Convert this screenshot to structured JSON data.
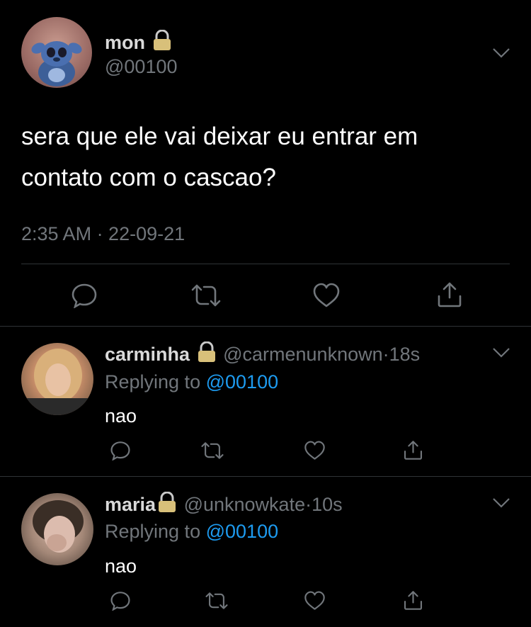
{
  "main_tweet": {
    "display_name": "mon",
    "handle": "@00100",
    "text_line1": "sera que ele vai deixar eu entrar em",
    "text_line2": "contato com o cascao?",
    "timestamp": "2:35 AM · 22-09-21",
    "avatar_icon": "stitch-avatar"
  },
  "replies": [
    {
      "display_name": "carminha",
      "handle": "@carmenunknown",
      "time": "18s",
      "replying_to_label": "Replying to",
      "replying_to_handle": "@00100",
      "text": "nao"
    },
    {
      "display_name": "maria",
      "handle": "@unknowkate",
      "time": "10s",
      "replying_to_label": "Replying to",
      "replying_to_handle": "@00100",
      "text": "nao"
    }
  ],
  "separator": "·",
  "icons": [
    "reply-icon",
    "retweet-icon",
    "like-icon",
    "share-icon",
    "lock-icon",
    "chevron-down-icon"
  ],
  "colors": {
    "background": "#000000",
    "text": "#ffffff",
    "muted": "#71767b",
    "link": "#1d9bf0",
    "divider": "#2f3336",
    "lock": "#d8c07a"
  }
}
